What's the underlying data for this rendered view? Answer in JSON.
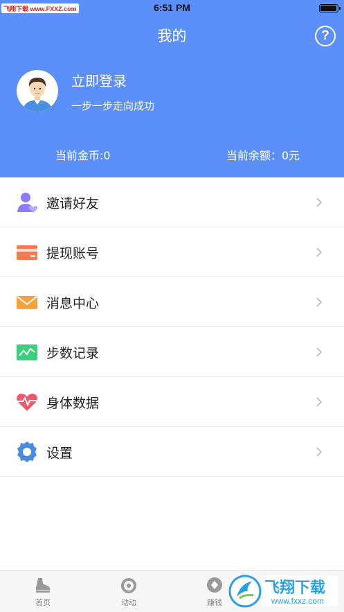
{
  "status_bar": {
    "watermark": "飞翔下载 www.FXXZ.com",
    "time": "6:51 PM",
    "battery_level": 0.95
  },
  "header": {
    "title": "我的",
    "help_icon": "question-circle-icon",
    "login_label": "立即登录",
    "slogan": "一步一步走向成功",
    "coins": "当前金币:0",
    "balance": "当前余额：0元",
    "background_color": "#5b8ff9"
  },
  "menu": {
    "items": [
      {
        "label": "邀请好友",
        "icon": "invite-friend-icon"
      },
      {
        "label": "提现账号",
        "icon": "card-icon"
      },
      {
        "label": "消息中心",
        "icon": "envelope-icon"
      },
      {
        "label": "步数记录",
        "icon": "chart-icon"
      },
      {
        "label": "身体数据",
        "icon": "heartbeat-icon"
      },
      {
        "label": "设置",
        "icon": "gear-icon"
      }
    ]
  },
  "tabbar": {
    "tabs": [
      {
        "label": "首页",
        "icon": "shoe-icon"
      },
      {
        "label": "动动",
        "icon": "ring-icon"
      },
      {
        "label": "赚钱",
        "icon": "diamond-icon"
      }
    ],
    "logo_text": "飞翔下载",
    "logo_url": "www.fxxz.com"
  }
}
